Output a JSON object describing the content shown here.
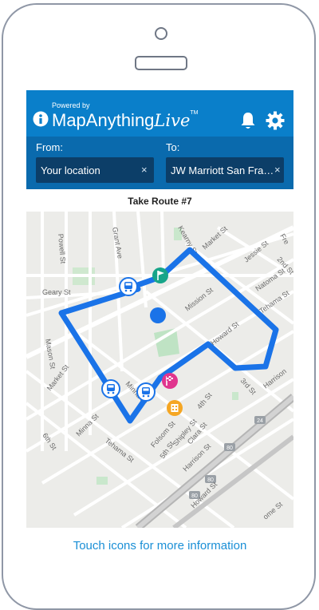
{
  "header": {
    "powered_by": "Powered by",
    "brand_main": "MapAnything",
    "brand_live": "Live",
    "brand_tm": "TM",
    "icons": [
      "info-icon",
      "bell-icon",
      "gear-icon"
    ]
  },
  "route": {
    "from_label": "From:",
    "from_value": "Your location",
    "to_label": "To:",
    "to_value": "JW Marriott San Fra…",
    "clear_symbol": "×"
  },
  "take_route": "Take Route #7",
  "map": {
    "streets": [
      {
        "name": "Geary St"
      },
      {
        "name": "Grant Ave"
      },
      {
        "name": "Powell St"
      },
      {
        "name": "Mason St"
      },
      {
        "name": "Market St"
      },
      {
        "name": "Kearny St"
      },
      {
        "name": "Market St"
      },
      {
        "name": "Jessie St"
      },
      {
        "name": "Natoma St"
      },
      {
        "name": "Tehama St"
      },
      {
        "name": "Mission St"
      },
      {
        "name": "Howard St"
      },
      {
        "name": "2nd St"
      },
      {
        "name": "3rd St"
      },
      {
        "name": "Harrison"
      },
      {
        "name": "Minna St"
      },
      {
        "name": "Minna St"
      },
      {
        "name": "Tehama St"
      },
      {
        "name": "6th St"
      },
      {
        "name": "4th St"
      },
      {
        "name": "5th St"
      },
      {
        "name": "Folsom St"
      },
      {
        "name": "Shipley St"
      },
      {
        "name": "Clara St"
      },
      {
        "name": "Harrison St"
      },
      {
        "name": "Howard St"
      },
      {
        "name": "ome St"
      },
      {
        "name": "Fre"
      }
    ],
    "highway_shields": [
      "80",
      "80",
      "80",
      "24"
    ],
    "route_color": "#1a73e8",
    "markers": [
      "bus-stop-icon",
      "bus-stop-icon",
      "bus-stop-icon",
      "start-flag-icon",
      "finish-flag-icon",
      "hotel-icon",
      "current-location-icon"
    ]
  },
  "footer_hint": "Touch icons for more information",
  "colors": {
    "header": "#0a7fca",
    "route_bar": "#0a6aad",
    "field": "#0c3e68",
    "accent": "#1a8fd6"
  }
}
